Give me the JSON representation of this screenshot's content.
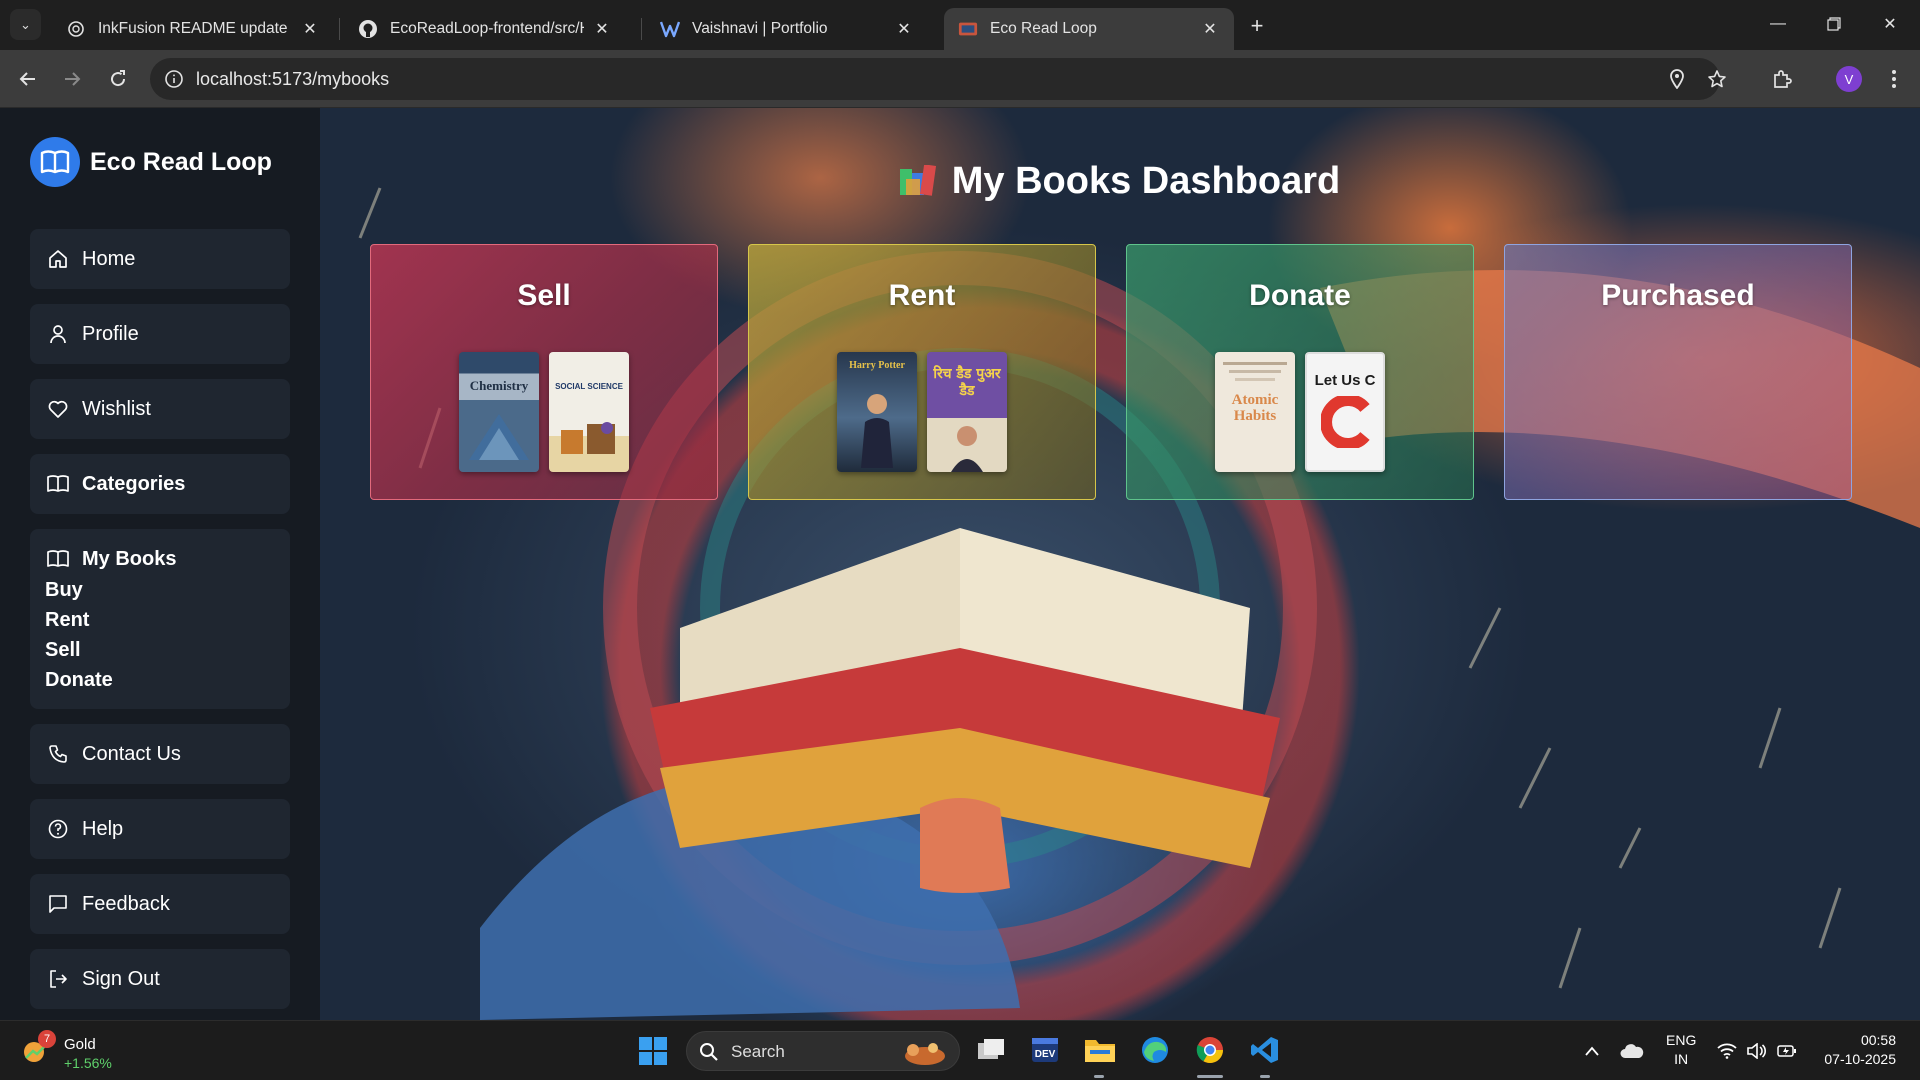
{
  "browser": {
    "tabs": [
      {
        "title": "InkFusion README update",
        "icon": "openai-icon",
        "active": false
      },
      {
        "title": "EcoReadLoop-frontend/src/Hon",
        "icon": "github-icon",
        "active": false
      },
      {
        "title": "Vaishnavi | Portfolio",
        "icon": "portfolio-icon",
        "active": false
      },
      {
        "title": "Eco Read Loop",
        "icon": "site-icon",
        "active": true
      }
    ],
    "url": "localhost:5173/mybooks",
    "profile_initial": "V"
  },
  "app": {
    "brand": "Eco Read Loop",
    "nav": {
      "home": "Home",
      "profile": "Profile",
      "wishlist": "Wishlist",
      "categories": "Categories",
      "my_books": "My Books",
      "my_books_sub": [
        "Buy",
        "Rent",
        "Sell",
        "Donate"
      ],
      "contact": "Contact Us",
      "help": "Help",
      "feedback": "Feedback",
      "sign_out": "Sign Out"
    },
    "dashboard": {
      "title": "My Books Dashboard",
      "cards": [
        {
          "title": "Sell",
          "covers": [
            "Chemistry",
            "SOCIAL SCIENCE"
          ]
        },
        {
          "title": "Rent",
          "covers": [
            "Harry Potter",
            "रिच डैड पुअर डैड"
          ]
        },
        {
          "title": "Donate",
          "covers": [
            "Atomic Habits",
            "Let Us C"
          ]
        },
        {
          "title": "Purchased",
          "covers": []
        }
      ]
    },
    "colors": {
      "sidebar": "#161b22",
      "nav_item": "#1f2630",
      "brand_logo": "#2f7bea",
      "sell": "#cd3755",
      "rent": "#beaa3c",
      "donate": "#3ca06e",
      "purchased": "#5f78c8"
    }
  },
  "taskbar": {
    "widget_label": "Gold",
    "widget_change": "+1.56%",
    "widget_badge": "7",
    "search_placeholder": "Search",
    "lang_top": "ENG",
    "lang_bottom": "IN",
    "time": "00:58",
    "date": "07-10-2025"
  }
}
